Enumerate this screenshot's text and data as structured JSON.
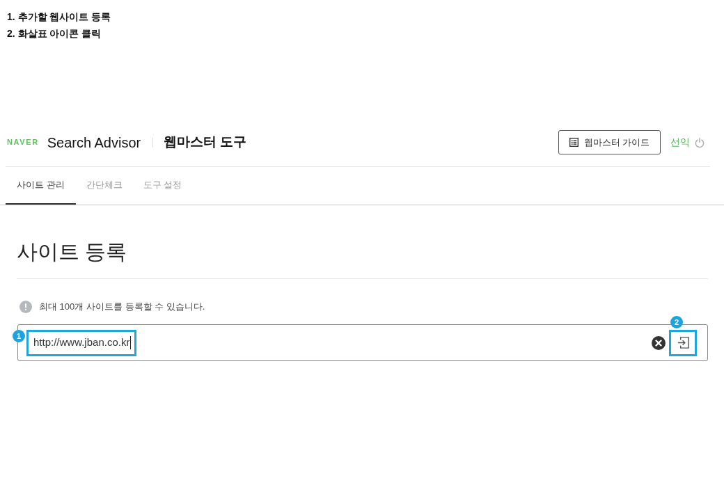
{
  "instructions": [
    "1. 추가할 웹사이트 등록",
    "2. 화살표 아이콘 클릭"
  ],
  "header": {
    "logo": "NAVER",
    "product": "Search Advisor",
    "title": "웹마스터 도구",
    "guide_button": "웹마스터 가이드",
    "user": "선익"
  },
  "tabs": [
    {
      "label": "사이트 관리",
      "selected": true
    },
    {
      "label": "간단체크",
      "selected": false
    },
    {
      "label": "도구 설정",
      "selected": false
    }
  ],
  "page_title": "사이트 등록",
  "notice": "최대 100개 사이트를 등록할 수 있습니다.",
  "url_field": {
    "value": "http://www.jban.co.kr",
    "focused": true,
    "callout": "1"
  },
  "submit_button": {
    "callout": "2"
  }
}
